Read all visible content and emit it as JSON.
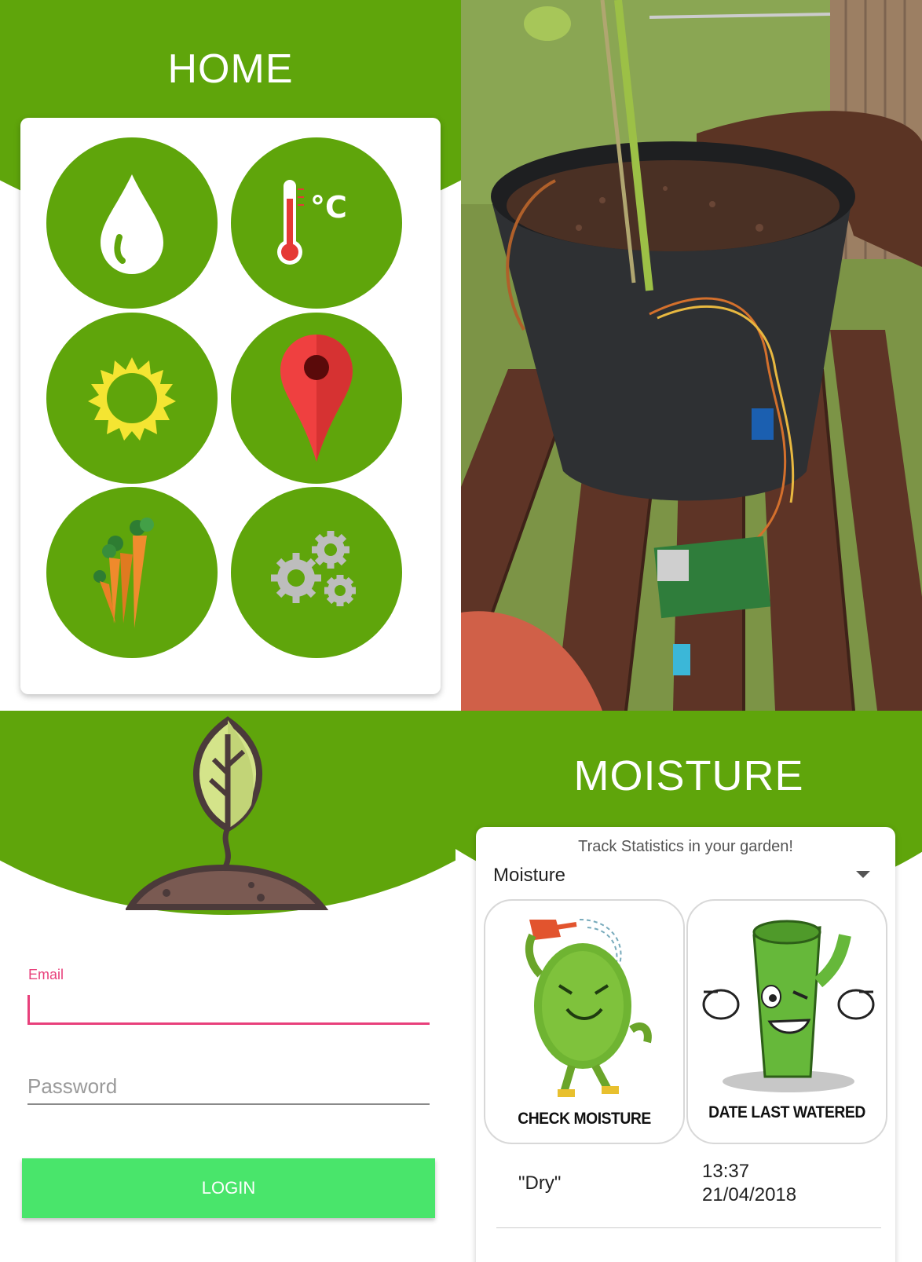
{
  "home": {
    "title": "HOME",
    "tiles": [
      {
        "icon": "water-drop-icon"
      },
      {
        "icon": "thermometer-icon",
        "text": "°C"
      },
      {
        "icon": "sun-icon"
      },
      {
        "icon": "location-pin-icon"
      },
      {
        "icon": "carrots-icon"
      },
      {
        "icon": "gears-icon"
      }
    ]
  },
  "photo": {
    "subject": "plant-pot-sensor-photo"
  },
  "login": {
    "email_label": "Email",
    "email_value": "",
    "password_placeholder": "Password",
    "login_button": "LOGIN"
  },
  "moisture": {
    "title": "MOISTURE",
    "subtitle": "Track Statistics in your garden!",
    "selected_option": "Moisture",
    "check_label": "CHECK MOISTURE",
    "date_label": "DATE LAST WATERED",
    "reading": "\"Dry\"",
    "time": "13:37",
    "date": "21/04/2018"
  },
  "colors": {
    "brand_green": "#5fa50b",
    "accent_pink": "#e8407b",
    "button_green": "#49e56b"
  }
}
